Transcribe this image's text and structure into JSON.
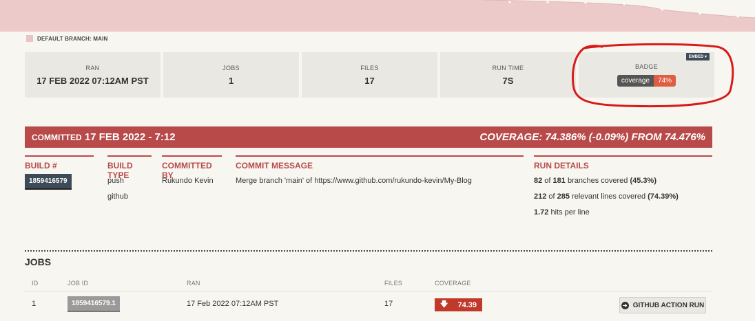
{
  "legend": {
    "label": "DEFAULT BRANCH: MAIN",
    "color": "#e8c4c4"
  },
  "stats": {
    "ran": {
      "label": "RAN",
      "value": "17 FEB 2022 07:12AM PST"
    },
    "jobs": {
      "label": "JOBS",
      "value": "1"
    },
    "files": {
      "label": "FILES",
      "value": "17"
    },
    "run_time": {
      "label": "RUN TIME",
      "value": "7S"
    },
    "badge": {
      "label": "BADGE",
      "embed_label": "EMBED",
      "badge_left": "coverage",
      "badge_right": "74%"
    }
  },
  "commit": {
    "label": "COMMITTED",
    "date": "17 FEB 2022 - 7:12",
    "coverage": "COVERAGE: 74.386% (-0.09%) FROM 74.476%"
  },
  "details": {
    "build_head": "BUILD #",
    "build_number": "1859416579",
    "build_type_head": "BUILD TYPE",
    "build_types": [
      "push",
      "github"
    ],
    "committed_by_head": "COMMITTED BY",
    "committed_by": "Rukundo Kevin",
    "message_head": "COMMIT MESSAGE",
    "message": "Merge branch 'main' of https://www.github.com/rukundo-kevin/My-Blog",
    "run_head": "RUN DETAILS",
    "run_lines": [
      {
        "a": "82",
        "mid": " of ",
        "b": "181",
        "rest": " branches covered ",
        "pct": "(45.3%)"
      },
      {
        "a": "212",
        "mid": " of ",
        "b": "285",
        "rest": " relevant lines covered ",
        "pct": "(74.39%)"
      },
      {
        "a": "1.72",
        "mid": "",
        "b": "",
        "rest": " hits per line",
        "pct": ""
      }
    ]
  },
  "jobs": {
    "title": "JOBS",
    "headers": {
      "id": "ID",
      "job_id": "JOB ID",
      "ran": "RAN",
      "files": "FILES",
      "coverage": "COVERAGE"
    },
    "rows": [
      {
        "id": "1",
        "job_id": "1859416579.1",
        "ran": "17 Feb 2022 07:12AM PST",
        "files": "17",
        "coverage": "74.39",
        "action": "GITHUB ACTION RUN"
      }
    ]
  },
  "colors": {
    "accent": "#b84a4a",
    "dark": "#3d4a57",
    "badge_red": "#e05d44"
  }
}
